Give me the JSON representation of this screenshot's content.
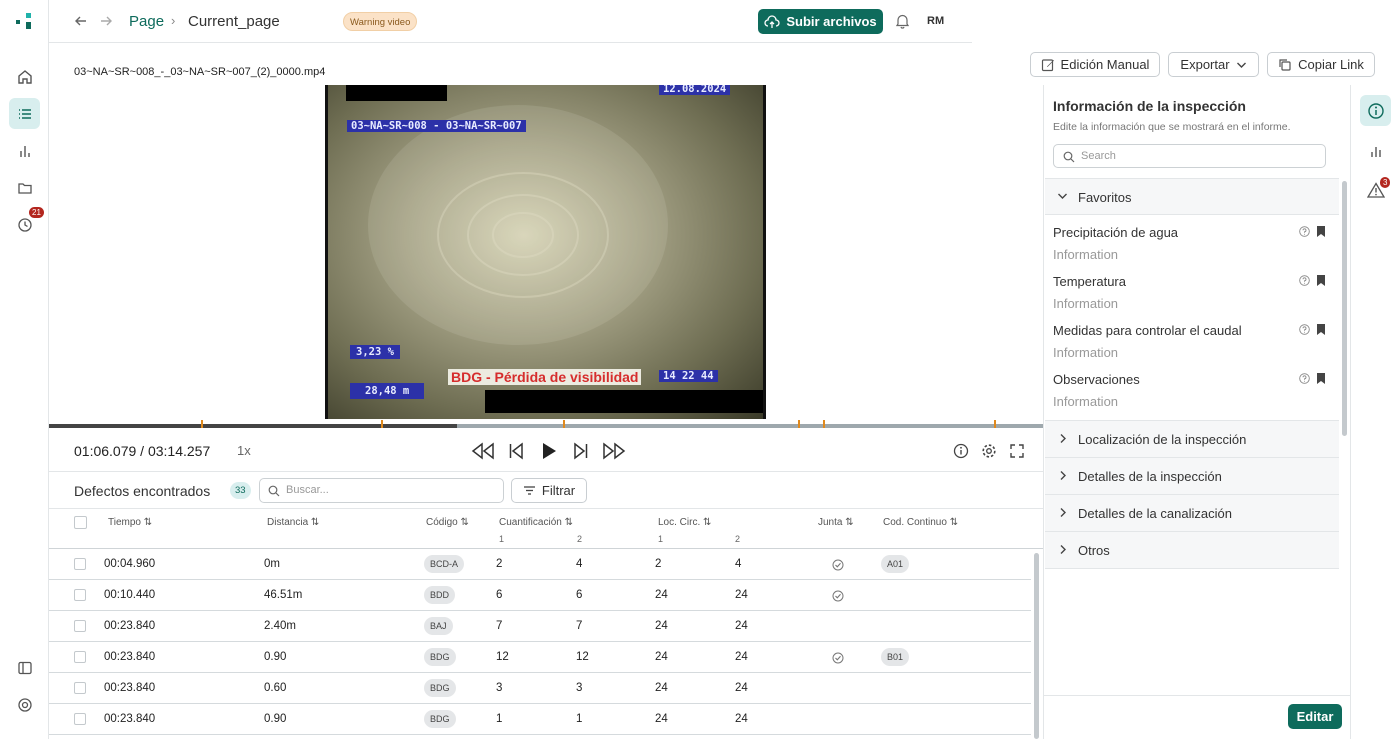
{
  "sidebar": {
    "history_badge": "21"
  },
  "header": {
    "crumb_page": "Page",
    "crumb_current": "Current_page",
    "warning": "Warning video",
    "upload": "Subir archivos",
    "avatar": "RM"
  },
  "toolbar": {
    "filename": "03~NA~SR~008_-_03~NA~SR~007_(2)_0000.mp4",
    "manual_edit": "Edición Manual",
    "export": "Exportar",
    "copy_link": "Copiar Link"
  },
  "video": {
    "date": "12.08.2024",
    "section": "03~NA~SR~008 - 03~NA~SR~007",
    "percent": "3,23 %",
    "distance": "28,48 m",
    "clock": "14 22 44",
    "defect_label": "BDG - Pérdida de visibilidad",
    "progress_fraction": 0.34,
    "markers": [
      0.153,
      0.334,
      0.517,
      0.754,
      0.779,
      0.951
    ]
  },
  "player": {
    "time": "01:06.079 / 03:14.257",
    "speed": "1x"
  },
  "defects": {
    "title": "Defectos encontrados",
    "count": "33",
    "search_placeholder": "Buscar...",
    "filter": "Filtrar",
    "columns": {
      "tiempo": "Tiempo",
      "distancia": "Distancia",
      "codigo": "Código",
      "cuant": "Cuantificación",
      "loc": "Loc. Circ.",
      "junta": "Junta",
      "cod_continuo": "Cod. Continuo",
      "sub1": "1",
      "sub2": "2"
    },
    "rows": [
      {
        "time": "00:04.960",
        "dist": "0m",
        "code": "BCD-A",
        "q1": "2",
        "q2": "4",
        "l1": "2",
        "l2": "4",
        "junta": true,
        "cont": "A01"
      },
      {
        "time": "00:10.440",
        "dist": "46.51m",
        "code": "BDD",
        "q1": "6",
        "q2": "6",
        "l1": "24",
        "l2": "24",
        "junta": true,
        "cont": ""
      },
      {
        "time": "00:23.840",
        "dist": "2.40m",
        "code": "BAJ",
        "q1": "7",
        "q2": "7",
        "l1": "24",
        "l2": "24",
        "junta": false,
        "cont": ""
      },
      {
        "time": "00:23.840",
        "dist": "0.90",
        "code": "BDG",
        "q1": "12",
        "q2": "12",
        "l1": "24",
        "l2": "24",
        "junta": true,
        "cont": "B01"
      },
      {
        "time": "00:23.840",
        "dist": "0.60",
        "code": "BDG",
        "q1": "3",
        "q2": "3",
        "l1": "24",
        "l2": "24",
        "junta": false,
        "cont": ""
      },
      {
        "time": "00:23.840",
        "dist": "0.90",
        "code": "BDG",
        "q1": "1",
        "q2": "1",
        "l1": "24",
        "l2": "24",
        "junta": false,
        "cont": ""
      }
    ]
  },
  "panel": {
    "title": "Información de la inspección",
    "subtitle": "Edite la información que se mostrará en el informe.",
    "search_placeholder": "Search",
    "favorites": "Favoritos",
    "fields": [
      {
        "label": "Precipitación de agua",
        "value": "Information"
      },
      {
        "label": "Temperatura",
        "value": "Information"
      },
      {
        "label": "Medidas para controlar el caudal",
        "value": "Information"
      },
      {
        "label": "Observaciones",
        "value": "Information"
      }
    ],
    "sections": [
      "Localización de la inspección",
      "Detalles de la inspección",
      "Detalles de la canalización",
      "Otros"
    ],
    "edit": "Editar"
  },
  "right_rail": {
    "alerts_badge": "3"
  },
  "colors": {
    "primary": "#0e6b5c",
    "warning_bg": "#fbe2c7",
    "marker": "#e08a1e",
    "danger": "#b3261e"
  }
}
